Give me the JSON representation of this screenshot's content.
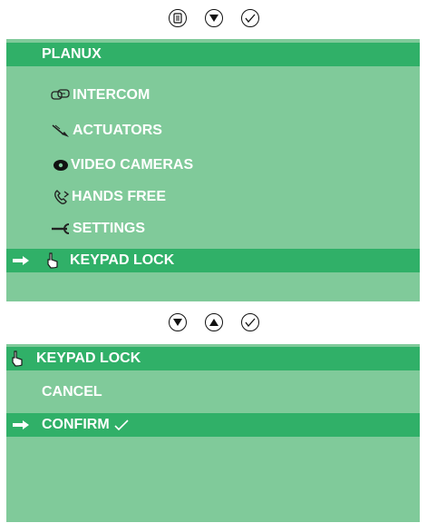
{
  "screen1": {
    "title": "PLANUX",
    "items": [
      {
        "icon": "intercom-icon",
        "label": "INTERCOM"
      },
      {
        "icon": "actuators-icon",
        "label": "ACTUATORS"
      },
      {
        "icon": "video-cameras-icon",
        "label": "VIDEO CAMERAS"
      },
      {
        "icon": "hands-free-icon",
        "label": "HANDS FREE"
      },
      {
        "icon": "settings-icon",
        "label": "SETTINGS"
      },
      {
        "icon": "keypad-lock-icon",
        "label": "KEYPAD LOCK",
        "selected": true
      }
    ],
    "buttons": [
      "menu-icon",
      "down-arrow-icon",
      "confirm-check-icon"
    ]
  },
  "screen2": {
    "title": "KEYPAD LOCK",
    "items": [
      {
        "label": "CANCEL"
      },
      {
        "label": "CONFIRM",
        "selected": true
      }
    ],
    "buttons": [
      "down-arrow-icon",
      "up-arrow-icon",
      "confirm-check-icon"
    ]
  },
  "colors": {
    "panel": "#80ca9a",
    "highlight": "#30b068",
    "text": "#ffffff"
  }
}
